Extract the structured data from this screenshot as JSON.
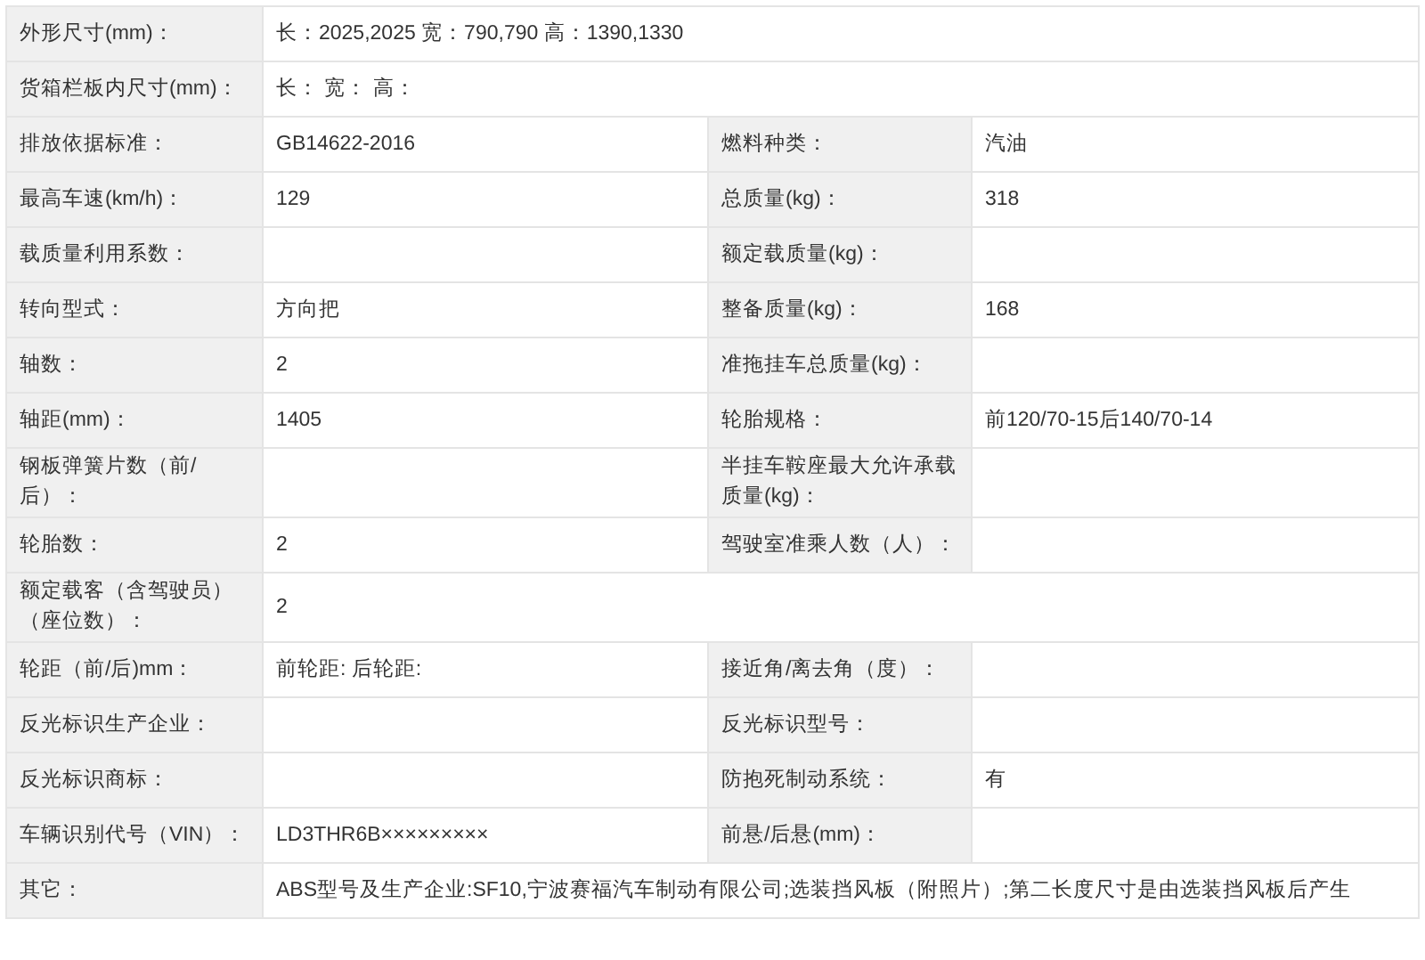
{
  "rows": [
    {
      "kind": "full",
      "label": "外形尺寸(mm)：",
      "value": "长：2025,2025 宽：790,790 高：1390,1330"
    },
    {
      "kind": "full",
      "label": "货箱栏板内尺寸(mm)：",
      "value": "长： 宽： 高："
    },
    {
      "kind": "pair",
      "cells": [
        {
          "label": "排放依据标准：",
          "value": "GB14622-2016"
        },
        {
          "label": "燃料种类：",
          "value": "汽油"
        }
      ]
    },
    {
      "kind": "pair",
      "cells": [
        {
          "label": "最高车速(km/h)：",
          "value": "129"
        },
        {
          "label": "总质量(kg)：",
          "value": "318"
        }
      ]
    },
    {
      "kind": "pair",
      "cells": [
        {
          "label": "载质量利用系数："
        },
        {
          "label": "额定载质量(kg)："
        }
      ]
    },
    {
      "kind": "pair",
      "cells": [
        {
          "label": "转向型式：",
          "value": "方向把"
        },
        {
          "label": "整备质量(kg)：",
          "value": "168"
        }
      ]
    },
    {
      "kind": "pair",
      "cells": [
        {
          "label": "轴数：",
          "value": "2"
        },
        {
          "label": "准拖挂车总质量(kg)："
        }
      ]
    },
    {
      "kind": "pair",
      "cells": [
        {
          "label": "轴距(mm)：",
          "value": "1405"
        },
        {
          "label": "轮胎规格：",
          "value": "前120/70-15后140/70-14"
        }
      ]
    },
    {
      "kind": "pair",
      "cells": [
        {
          "label": "钢板弹簧片数（前/后）："
        },
        {
          "label": "半挂车鞍座最大允许承载质量(kg)："
        }
      ]
    },
    {
      "kind": "pair",
      "cells": [
        {
          "label": "轮胎数：",
          "value": "2"
        },
        {
          "label": "驾驶室准乘人数（人）："
        }
      ]
    },
    {
      "kind": "full",
      "label": "额定载客（含驾驶员）（座位数）：",
      "value": "2"
    },
    {
      "kind": "pair",
      "cells": [
        {
          "label": "轮距（前/后)mm：",
          "value": "前轮距: 后轮距:"
        },
        {
          "label": "接近角/离去角（度）："
        }
      ]
    },
    {
      "kind": "pair",
      "cells": [
        {
          "label": "反光标识生产企业："
        },
        {
          "label": "反光标识型号："
        }
      ]
    },
    {
      "kind": "pair",
      "cells": [
        {
          "label": "反光标识商标："
        },
        {
          "label": "防抱死制动系统：",
          "value": "有"
        }
      ]
    },
    {
      "kind": "pair",
      "cells": [
        {
          "label": "车辆识别代号（VIN）：",
          "value": "LD3THR6B×××××××××"
        },
        {
          "label": "前悬/后悬(mm)："
        }
      ]
    },
    {
      "kind": "full",
      "label": "其它：",
      "value": "ABS型号及生产企业:SF10,宁波赛福汽车制动有限公司;选装挡风板（附照片）;第二长度尺寸是由选装挡风板后产生"
    }
  ]
}
